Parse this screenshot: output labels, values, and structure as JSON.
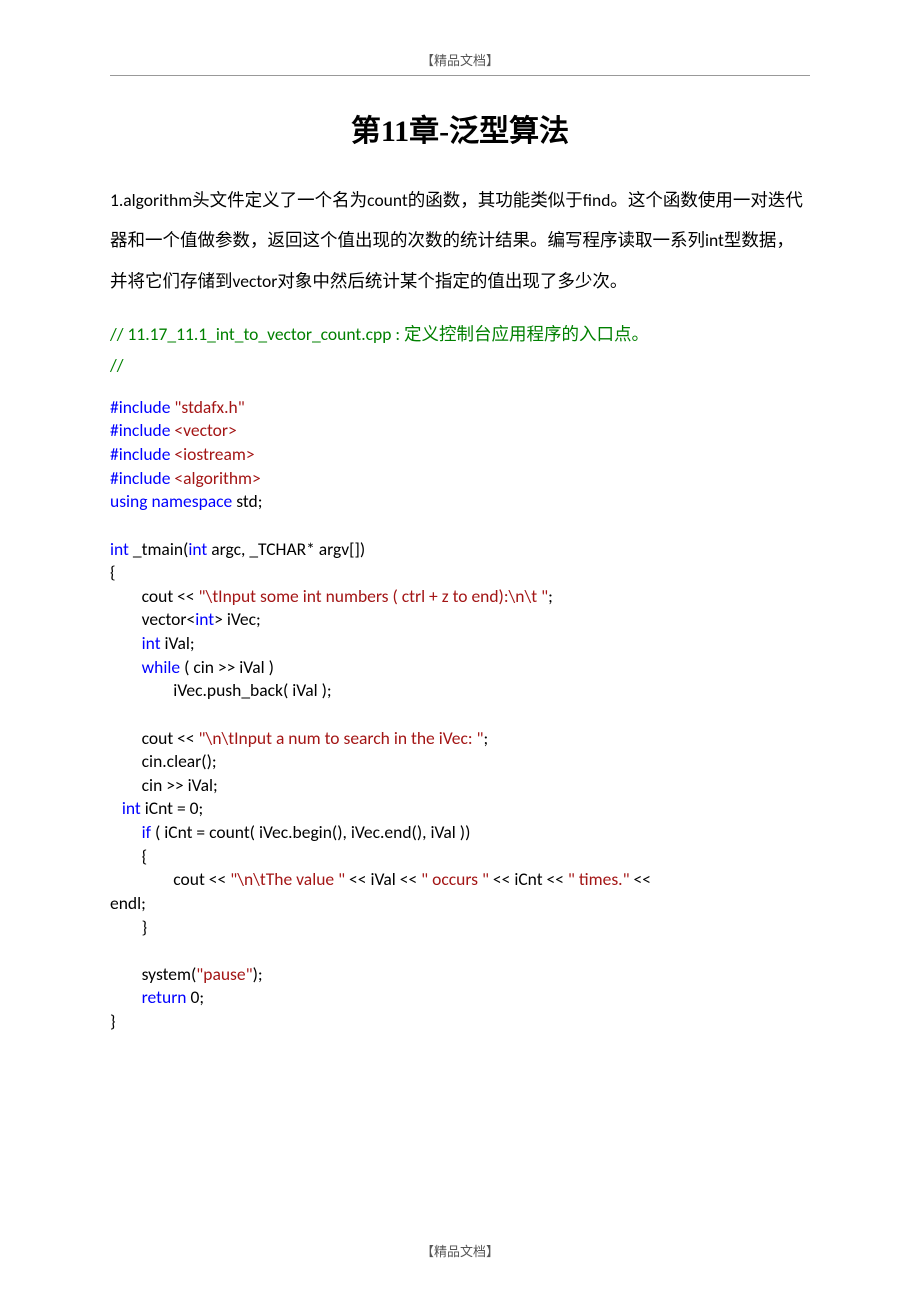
{
  "header": {
    "badge": "【精品文档】"
  },
  "title": "第11章-泛型算法",
  "intro": "1.algorithm头文件定义了一个名为count的函数，其功能类似于find。这个函数使用一对迭代器和一个值做参数，返回这个值出现的次数的统计结果。编写程序读取一系列int型数据，并将它们存储到vector对象中然后统计某个指定的值出现了多少次。",
  "comment": {
    "line1": "// 11.17_11.1_int_to_vector_count.cpp : 定义控制台应用程序的入口点。",
    "line2": "//"
  },
  "code": {
    "kw_include1": "#include",
    "str_stdafx": " \"stdafx.h\"",
    "kw_include2": "#include",
    "str_vector": " <vector>",
    "kw_include3": "#include",
    "str_iostream": " <iostream>",
    "kw_include4": "#include",
    "str_algorithm": " <algorithm>",
    "kw_using": "using",
    "kw_namespace": " namespace",
    "txt_std": " std;",
    "kw_int1": "int",
    "txt_tmain": " _tmain(",
    "kw_int2": "int",
    "txt_args": " argc, _TCHAR* argv[])",
    "brace_open": "{",
    "txt_cout1a": "        cout << ",
    "str_prompt1": "\"\\tInput some int numbers ( ctrl + z to end):\\n\\t \"",
    "txt_cout1b": ";",
    "txt_vecdecl_a": "        vector<",
    "kw_int3": "int",
    "txt_vecdecl_b": "> iVec;",
    "txt_ivaldecl_a": "        ",
    "kw_int4": "int",
    "txt_ivaldecl_b": " iVal;",
    "txt_while_a": "        ",
    "kw_while": "while",
    "txt_while_b": " ( cin >> iVal )",
    "txt_push": "                iVec.push_back( iVal );",
    "txt_cout2a": "        cout << ",
    "str_prompt2": "\"\\n\\tInput a num to search in the iVec: \"",
    "txt_cout2b": ";",
    "txt_cinclear": "        cin.clear();",
    "txt_cinival": "        cin >> iVal;",
    "txt_icnt_a": "   ",
    "kw_int5": "int",
    "txt_icnt_b": " iCnt = 0;",
    "txt_if_a": "        ",
    "kw_if": "if",
    "txt_if_b": " ( iCnt = count( iVec.begin(), iVec.end(), iVal ))",
    "txt_ifopen": "        {",
    "txt_cout3a": "                cout << ",
    "str_val": "\"\\n\\tThe value \"",
    "txt_cout3b": " << iVal << ",
    "str_occurs": "\" occurs \"",
    "txt_cout3c": " << iCnt << ",
    "str_times": "\" times.\"",
    "txt_cout3d": " <<",
    "txt_endl": "endl;",
    "txt_ifclose": "        }",
    "txt_system_a": "        system(",
    "str_pause": "\"pause\"",
    "txt_system_b": ");",
    "txt_return_a": "        ",
    "kw_return": "return",
    "txt_return_b": " 0;",
    "brace_close": "}"
  },
  "footer": {
    "badge": "【精品文档】"
  }
}
